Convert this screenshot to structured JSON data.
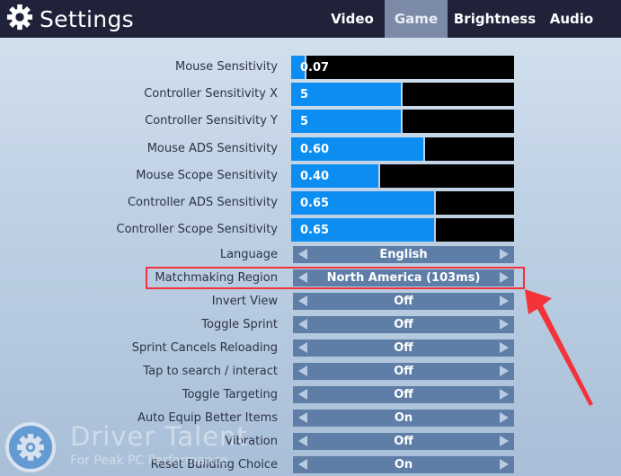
{
  "header": {
    "title": "Settings",
    "icon": "gear-icon",
    "tabs": [
      {
        "label": "Video",
        "active": false
      },
      {
        "label": "Game",
        "active": true
      },
      {
        "label": "Brightness",
        "active": false
      },
      {
        "label": "Audio",
        "active": false
      }
    ]
  },
  "sliders": [
    {
      "label": "Mouse Sensitivity",
      "value": "0.07",
      "fill_fraction": 0.07
    },
    {
      "label": "Controller Sensitivity X",
      "value": "5",
      "fill_fraction": 0.5
    },
    {
      "label": "Controller Sensitivity Y",
      "value": "5",
      "fill_fraction": 0.5
    },
    {
      "label": "Mouse ADS Sensitivity",
      "value": "0.60",
      "fill_fraction": 0.6
    },
    {
      "label": "Mouse Scope Sensitivity",
      "value": "0.40",
      "fill_fraction": 0.4
    },
    {
      "label": "Controller ADS Sensitivity",
      "value": "0.65",
      "fill_fraction": 0.65
    },
    {
      "label": "Controller Scope Sensitivity",
      "value": "0.65",
      "fill_fraction": 0.65
    }
  ],
  "selectors": [
    {
      "label": "Language",
      "value": "English"
    },
    {
      "label": "Matchmaking Region",
      "value": "North America (103ms)",
      "highlighted": true
    },
    {
      "label": "Invert View",
      "value": "Off"
    },
    {
      "label": "Toggle Sprint",
      "value": "Off"
    },
    {
      "label": "Sprint Cancels Reloading",
      "value": "Off"
    },
    {
      "label": "Tap to search / interact",
      "value": "Off"
    },
    {
      "label": "Toggle Targeting",
      "value": "Off"
    },
    {
      "label": "Auto Equip Better Items",
      "value": "On"
    },
    {
      "label": "Vibration",
      "value": "Off"
    },
    {
      "label": "Reset Building Choice",
      "value": "On"
    }
  ],
  "annotation": {
    "highlight_color": "#f2333a"
  },
  "watermark": {
    "title": "Driver Talent",
    "subtitle": "For Peak PC Performance"
  },
  "colors": {
    "topbar": "#1f2239",
    "active_tab": "#7b8aa6",
    "slider_fill": "#0b8df2",
    "slider_track": "#000000",
    "selector_bg": "#5e7ea7"
  }
}
